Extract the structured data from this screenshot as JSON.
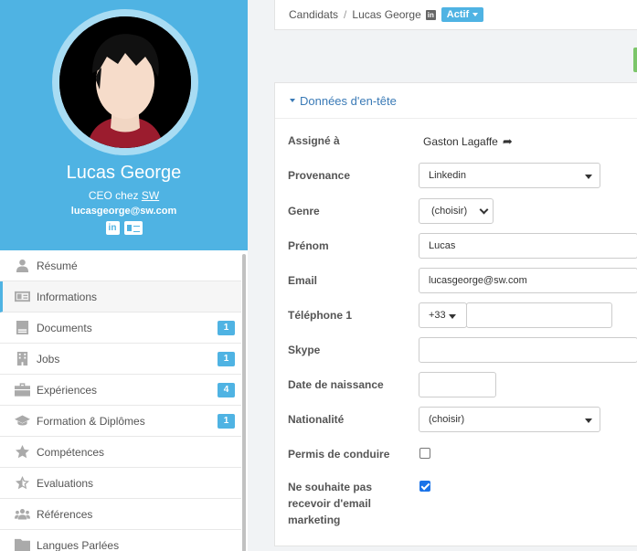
{
  "profile": {
    "name": "Lucas George",
    "title_prefix": "CEO chez ",
    "company": "SW",
    "email": "lucasgeorge@sw.com",
    "linkedin_label": "in"
  },
  "nav": {
    "items": [
      {
        "label": "Résumé",
        "icon": "user-icon",
        "badge": ""
      },
      {
        "label": "Informations",
        "icon": "id-card-icon",
        "badge": "",
        "active": true
      },
      {
        "label": "Documents",
        "icon": "document-icon",
        "badge": "1"
      },
      {
        "label": "Jobs",
        "icon": "building-icon",
        "badge": "1"
      },
      {
        "label": "Expériences",
        "icon": "briefcase-icon",
        "badge": "4"
      },
      {
        "label": "Formation & Diplômes",
        "icon": "graduation-cap-icon",
        "badge": "1"
      },
      {
        "label": "Compétences",
        "icon": "star-icon",
        "badge": ""
      },
      {
        "label": "Evaluations",
        "icon": "half-star-icon",
        "badge": ""
      },
      {
        "label": "Références",
        "icon": "users-icon",
        "badge": ""
      },
      {
        "label": "Langues Parlées",
        "icon": "folder-icon",
        "badge": ""
      }
    ]
  },
  "breadcrumb": {
    "root": "Candidats",
    "separator": "/",
    "current": "Lucas George",
    "linkedin_label": "in",
    "status": "Actif"
  },
  "panel": {
    "title": "Données d'en-tête",
    "fields": {
      "assigne_label": "Assigné à",
      "assigne_value": "Gaston Lagaffe",
      "provenance_label": "Provenance",
      "provenance_value": "Linkedin",
      "genre_label": "Genre",
      "genre_value": "(choisir)",
      "prenom_label": "Prénom",
      "prenom_value": "Lucas",
      "email_label": "Email",
      "email_value": "lucasgeorge@sw.com",
      "tel_label": "Téléphone 1",
      "tel_prefix": "+33",
      "tel_value": "",
      "skype_label": "Skype",
      "skype_value": "",
      "naissance_label": "Date de naissance",
      "naissance_value": "",
      "nationalite_label": "Nationalité",
      "nationalite_value": "(choisir)",
      "permis_label": "Permis de conduire",
      "permis_checked": false,
      "marketing_label_1": "Ne souhaite pas",
      "marketing_label_2": "recevoir d'email",
      "marketing_label_3": "marketing",
      "marketing_checked": true
    }
  },
  "colors": {
    "accent": "#4fb3e3",
    "link": "#3a7ab6",
    "success": "#7cc66a"
  }
}
